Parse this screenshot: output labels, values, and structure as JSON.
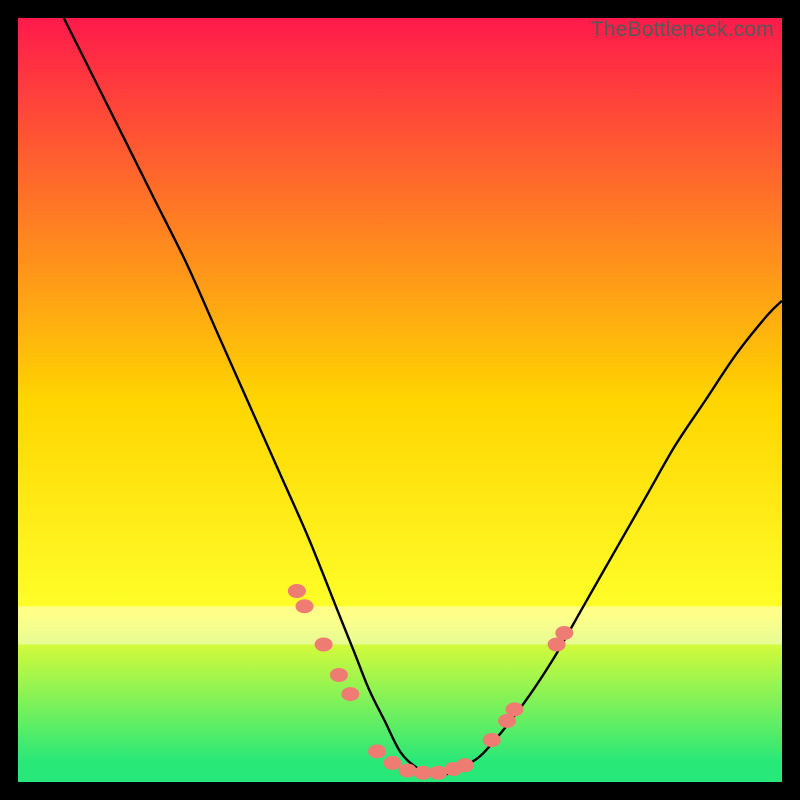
{
  "attribution": "TheBottleneck.com",
  "colors": {
    "bg_top": "#ff1a4b",
    "bg_mid": "#ffd500",
    "bg_yellow": "#ffff2a",
    "bg_green": "#27e879",
    "curve": "#000000",
    "marker": "#ef7c73"
  },
  "chart_data": {
    "type": "line",
    "title": "",
    "xlabel": "",
    "ylabel": "",
    "xlim": [
      0,
      100
    ],
    "ylim": [
      0,
      100
    ],
    "series": [
      {
        "name": "bottleneck-curve",
        "x": [
          6,
          10,
          14,
          18,
          22,
          26,
          30,
          34,
          38,
          42,
          44,
          46,
          48,
          50,
          52,
          54,
          56,
          58,
          60,
          62,
          66,
          70,
          74,
          78,
          82,
          86,
          90,
          94,
          98,
          100
        ],
        "y": [
          100,
          92,
          84,
          76,
          68,
          59,
          50,
          41,
          32,
          22,
          17,
          12,
          8,
          4,
          2,
          1,
          1,
          2,
          3,
          5,
          10,
          16,
          23,
          30,
          37,
          44,
          50,
          56,
          61,
          63
        ]
      }
    ],
    "markers": {
      "name": "highlight-points",
      "x": [
        36.5,
        37.5,
        40,
        42,
        43.5,
        47,
        49,
        51,
        53,
        55,
        57,
        58.5,
        62,
        64,
        65,
        70.5,
        71.5
      ],
      "y": [
        25,
        23,
        18,
        14,
        11.5,
        4,
        2.5,
        1.5,
        1.2,
        1.2,
        1.7,
        2.2,
        5.5,
        8,
        9.5,
        18,
        19.5
      ]
    },
    "gradient_stops": [
      {
        "offset": 0.0,
        "key": "bg_top"
      },
      {
        "offset": 0.5,
        "key": "bg_mid"
      },
      {
        "offset": 0.78,
        "key": "bg_yellow"
      },
      {
        "offset": 0.975,
        "key": "bg_green"
      },
      {
        "offset": 1.0,
        "key": "bg_green"
      }
    ],
    "pale_band": {
      "from": 0.77,
      "to": 0.82,
      "alpha": 0.45
    }
  }
}
